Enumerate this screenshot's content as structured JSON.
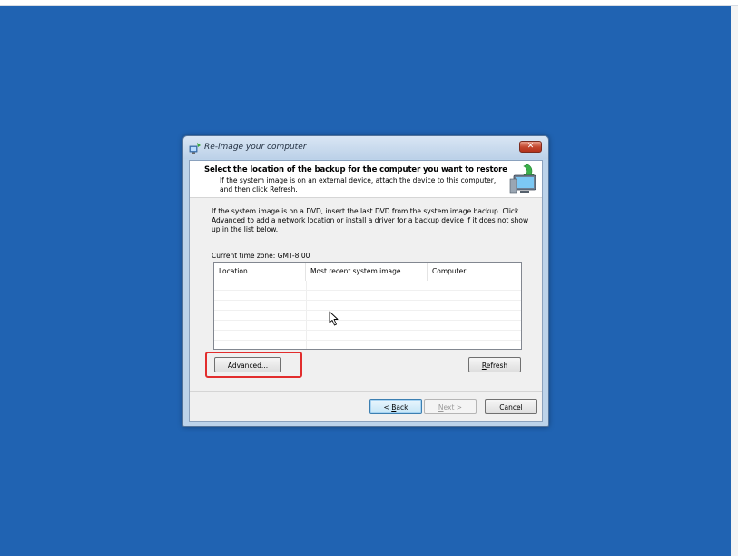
{
  "dialog": {
    "title": "Re-image your computer",
    "heading": "Select the location of the backup for the computer you want to restore",
    "description": "If the system image is on an external device, attach the device to this computer, and then click Refresh.",
    "instructions": "If the system image is on a DVD, insert the last DVD from the system image backup. Click Advanced to add a network location or install a driver for a backup device if it does not show up in the list below.",
    "time_zone": "Current time zone: GMT-8:00",
    "table": {
      "columns": [
        "Location",
        "Most recent system image",
        "Computer"
      ],
      "rows": []
    },
    "buttons": {
      "advanced": "Advanced...",
      "refresh_prefix": "",
      "refresh_key": "R",
      "refresh_rest": "efresh",
      "back_prefix": "< ",
      "back_key": "B",
      "back_rest": "ack",
      "next_key": "N",
      "next_rest": "ext >",
      "cancel": "Cancel"
    },
    "close_glyph": "✕"
  },
  "colors": {
    "desktop": "#2063b2",
    "highlight": "#e22d2d"
  },
  "icons": {
    "title": "restore-icon",
    "header": "computer-backup-icon",
    "cursor": "mouse-pointer-icon"
  }
}
